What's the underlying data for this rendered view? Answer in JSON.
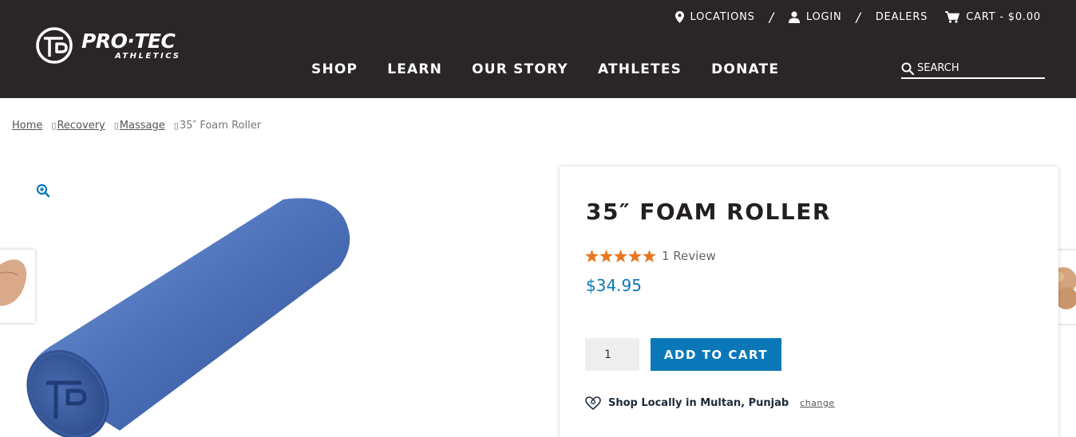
{
  "brand": {
    "name": "PRO·TEC",
    "sub": "ATHLETICS"
  },
  "utility_nav": {
    "locations": "LOCATIONS",
    "separator": "/",
    "login": "LOGIN",
    "dealers": "DEALERS",
    "cart": "CART - $0.00"
  },
  "main_nav": [
    "SHOP",
    "LEARN",
    "OUR STORY",
    "ATHLETES",
    "DONATE"
  ],
  "search": {
    "placeholder": "SEARCH"
  },
  "breadcrumb": {
    "items": [
      "Home",
      "Recovery",
      "Massage"
    ],
    "current": "35″ Foam Roller",
    "glyph": "▯"
  },
  "product": {
    "title": "35″ FOAM ROLLER",
    "rating": 5,
    "review_text": "1 Review",
    "price": "$34.95",
    "quantity": "1",
    "add_to_cart": "ADD TO CART",
    "local_text": "Shop Locally in Multan, Punjab",
    "local_change": "change"
  },
  "colors": {
    "header_bg": "#2a2526",
    "accent": "#0a78b8",
    "star": "#e87722",
    "product_blue": "#4a6fb5"
  },
  "icons": [
    "map-pin-icon",
    "user-icon",
    "cart-icon",
    "search-icon",
    "zoom-icon",
    "star-icon",
    "heart-pin-icon"
  ]
}
